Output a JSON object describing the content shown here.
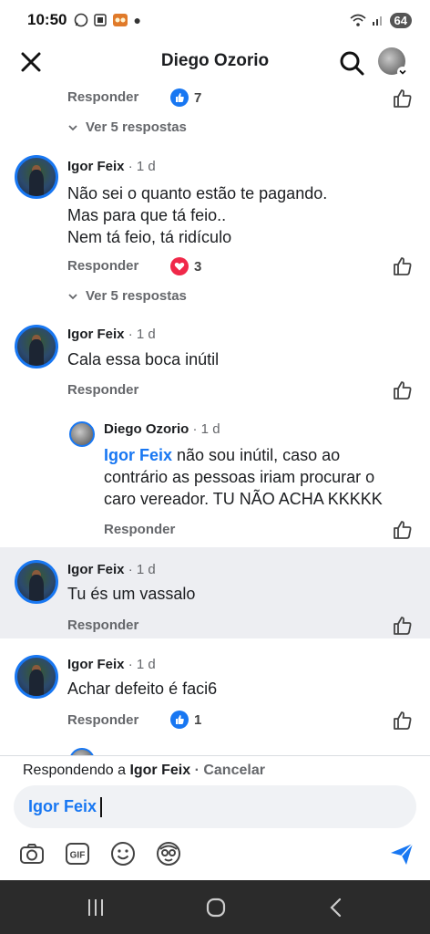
{
  "status": {
    "time": "10:50",
    "battery": "64"
  },
  "header": {
    "title": "Diego Ozorio"
  },
  "thread": {
    "top_reply_label": "Responder",
    "top_like_count": "7",
    "top_view_replies": "Ver 5 respostas",
    "comments": [
      {
        "author": "Igor Feix",
        "time": "· 1 d",
        "lines": [
          "Não sei o quanto estão te pagando.",
          "Mas para que tá feio..",
          "Nem tá feio, tá ridículo"
        ],
        "reply_label": "Responder",
        "reaction_count": "3",
        "view_replies": "Ver 5 respostas"
      },
      {
        "author": "Igor Feix",
        "time": "· 1 d",
        "text": "Cala essa boca inútil",
        "reply_label": "Responder"
      },
      {
        "author": "Diego Ozorio",
        "time": "· 1 d",
        "mention": "Igor Feix",
        "text_line1": " não sou inútil,  caso ao",
        "text_line2": "contrário as pessoas iriam procurar o",
        "text_line3": "caro vereador. TU NÃO ACHA KKKKK",
        "reply_label": "Responder"
      },
      {
        "author": "Igor Feix",
        "time": "· 1 d",
        "text": "Tu és um vassalo",
        "reply_label": "Responder"
      },
      {
        "author": "Igor Feix",
        "time": "· 1 d",
        "text": "Achar defeito é faci6",
        "reply_label": "Responder",
        "like_count": "1"
      }
    ]
  },
  "composer": {
    "replying_prefix": "Respondendo a ",
    "replying_to": "Igor Feix",
    "cancel_label": "· Cancelar",
    "input_value": "Igor Feix"
  },
  "colors": {
    "accent": "#1877f2",
    "muted": "#65676b",
    "highlight": "#edeef2",
    "love": "#f02849"
  }
}
